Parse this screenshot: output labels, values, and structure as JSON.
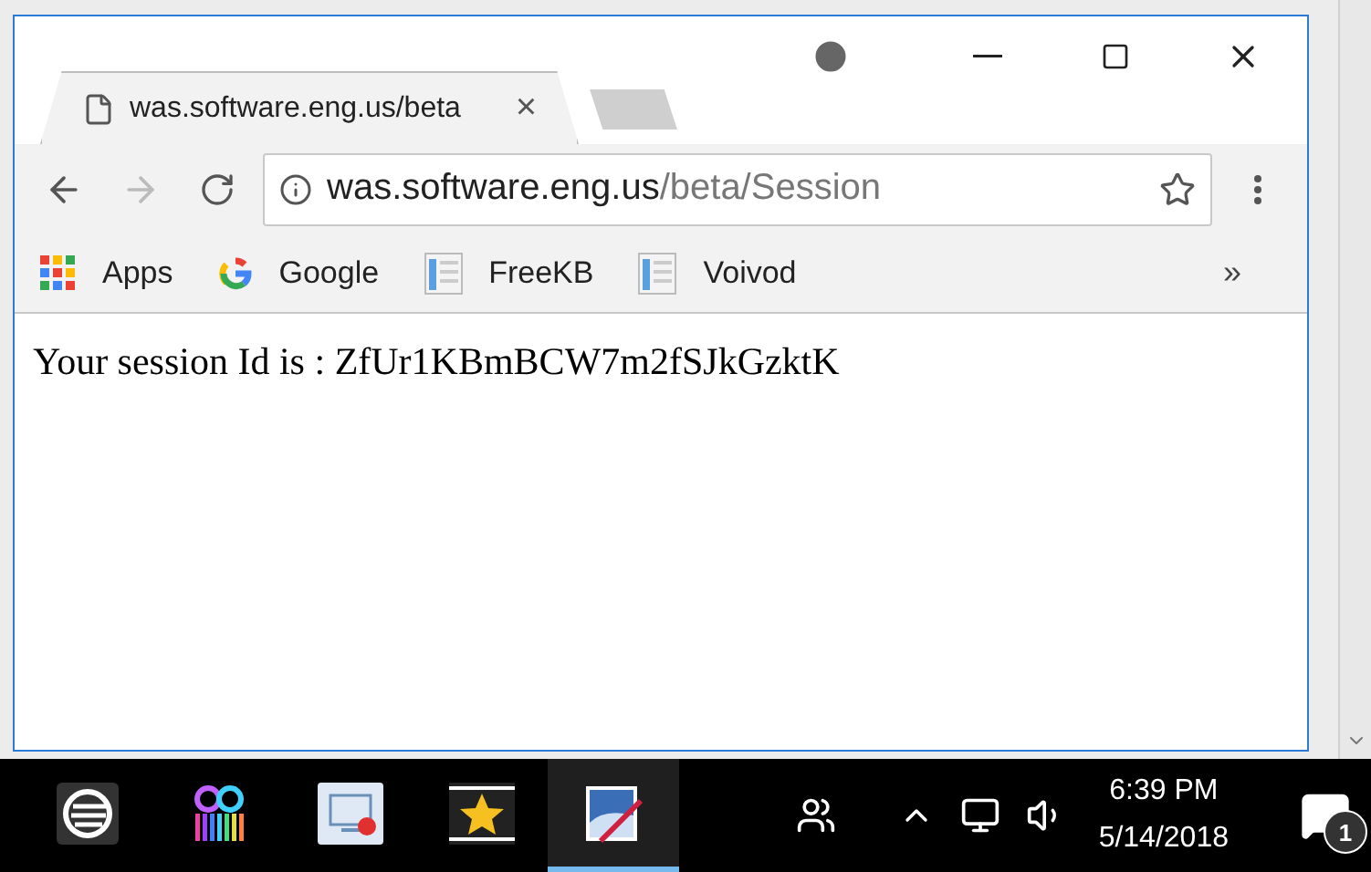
{
  "browser": {
    "tab": {
      "title": "was.software.eng.us/beta",
      "close": "×",
      "selected": true
    },
    "nav": {
      "back_disabled": false,
      "forward_disabled": true
    },
    "address": {
      "host": "was.software.eng.us",
      "path": "/beta/Session"
    },
    "bookmarks": [
      {
        "label": "Apps",
        "kind": "apps"
      },
      {
        "label": "Google",
        "kind": "google"
      },
      {
        "label": "FreeKB",
        "kind": "page"
      },
      {
        "label": "Voivod",
        "kind": "page"
      }
    ],
    "bookmarks_overflow": "»",
    "content": "Your session Id is : ZfUr1KBmBCW7m2fSJkGzktK"
  },
  "taskbar": {
    "apps": [
      {
        "kind": "globe",
        "active": false
      },
      {
        "kind": "film",
        "active": false
      },
      {
        "kind": "screen",
        "active": false
      },
      {
        "kind": "star",
        "active": false
      },
      {
        "kind": "paint",
        "active": true
      }
    ],
    "time": "6:39 PM",
    "date": "5/14/2018",
    "notifications": "1"
  }
}
